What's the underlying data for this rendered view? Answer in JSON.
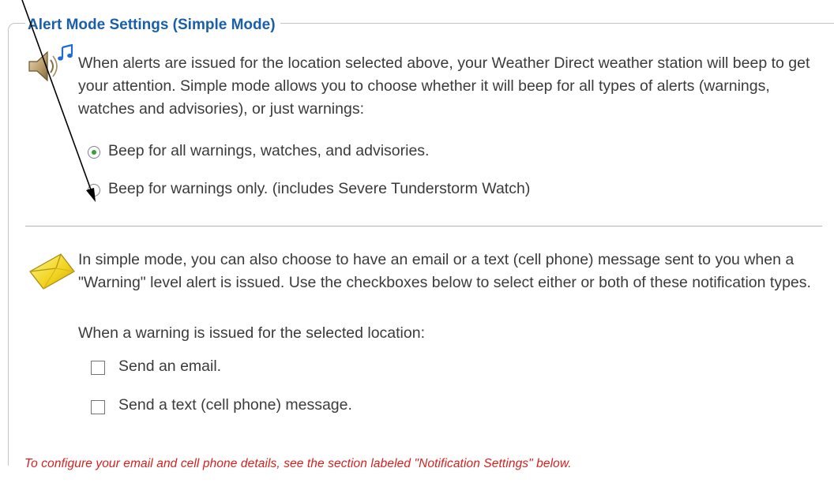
{
  "panel": {
    "legend": "Alert Mode Settings (Simple Mode)"
  },
  "alerts_section": {
    "icon": "speaker-music-icon",
    "description": "When alerts are issued for the location selected above, your Weather Direct weather station will beep to get your attention. Simple mode allows you to choose whether it will beep for all types of alerts (warnings, watches and advisories), or just warnings:",
    "options": [
      {
        "label": "Beep for all warnings, watches, and advisories.",
        "selected": true
      },
      {
        "label": "Beep for warnings only. (includes Severe Tunderstorm Watch)",
        "selected": false
      }
    ]
  },
  "notify_section": {
    "icon": "envelope-icon",
    "description": "In simple mode, you can also choose to have an email or a text (cell phone) message sent to you when a \"Warning\" level alert is issued. Use the checkboxes below to select either or both of these notification types.",
    "prompt": "When a warning is issued for the selected location:",
    "checkboxes": [
      {
        "label": "Send an email.",
        "checked": false
      },
      {
        "label": "Send a text (cell phone) message.",
        "checked": false
      }
    ]
  },
  "footer_note": "To configure your email and cell phone details, see the section labeled \"Notification Settings\" below.",
  "colors": {
    "legend": "#1a5faa",
    "note": "#d61f1f",
    "radio_selected": "#37a036",
    "arrow": "#000000"
  }
}
